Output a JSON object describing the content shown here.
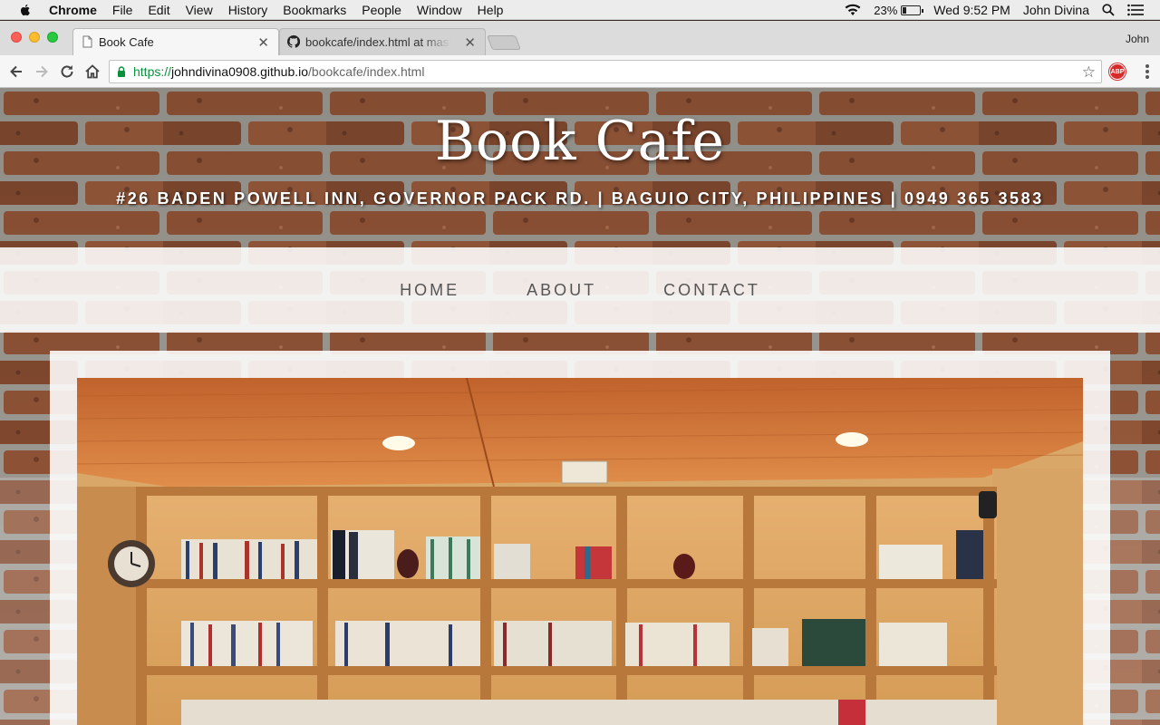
{
  "menubar": {
    "app_name": "Chrome",
    "items": [
      "File",
      "Edit",
      "View",
      "History",
      "Bookmarks",
      "People",
      "Window",
      "Help"
    ],
    "battery_percent": "23%",
    "battery_level": 0.23,
    "clock": "Wed 9:52 PM",
    "user": "John Divina"
  },
  "browser": {
    "tabs": [
      {
        "title": "Book Cafe",
        "active": true
      },
      {
        "title": "bookcafe/index.html at master",
        "active": false
      }
    ],
    "profile_name": "John",
    "url": {
      "scheme": "https://",
      "host": "johndivina0908.github.io",
      "path": "/bookcafe/index.html"
    },
    "extension_badge": "ABP"
  },
  "site": {
    "brand": "Book Cafe",
    "address": "#26 Baden Powell Inn, Governor Pack Rd. | Baguio City, Philippines | 0949 365 3583",
    "nav": [
      "Home",
      "About",
      "Contact"
    ]
  },
  "colors": {
    "accent_green": "#0a8f3c",
    "abp_red": "#d62b2b",
    "brick": "#9a5a3c",
    "wood": "#c98a45"
  }
}
